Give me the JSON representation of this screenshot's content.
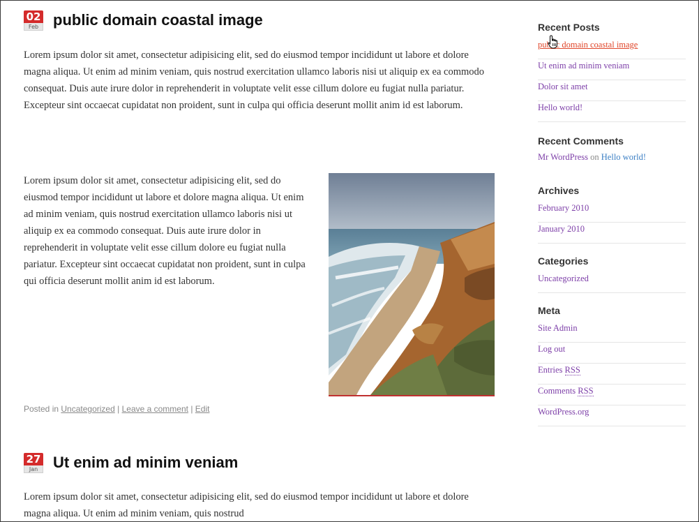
{
  "posts": [
    {
      "day": "02",
      "month": "Feb",
      "title": "public domain coastal image",
      "paragraphs": [
        "Lorem ipsum dolor sit amet, consectetur adipisicing elit, sed do eiusmod tempor incididunt ut labore et dolore magna aliqua. Ut enim ad minim veniam, quis nostrud exercitation ullamco laboris nisi ut aliquip ex ea commodo consequat. Duis aute irure dolor in reprehenderit in voluptate velit esse cillum dolore eu fugiat nulla pariatur. Excepteur sint occaecat cupidatat non proident, sunt in culpa qui officia deserunt mollit anim id est laborum.",
        "Lorem ipsum dolor sit amet, consectetur adipisicing elit, sed do eiusmod tempor incididunt ut labore et dolore magna aliqua. Ut enim ad minim veniam, quis nostrud exercitation ullamco laboris nisi ut aliquip ex ea commodo consequat. Duis aute irure dolor in reprehenderit in voluptate velit esse cillum dolore eu fugiat nulla pariatur. Excepteur sint occaecat cupidatat non proident, sunt in culpa qui officia deserunt mollit anim id est laborum."
      ],
      "meta": {
        "posted_in": "Posted in",
        "category": "Uncategorized",
        "sep": "|",
        "comment": "Leave a comment",
        "edit": "Edit"
      }
    },
    {
      "day": "27",
      "month": "Jan",
      "title": "Ut enim ad minim veniam",
      "paragraphs": [
        "Lorem ipsum dolor sit amet, consectetur adipisicing elit, sed do eiusmod tempor incididunt ut labore et dolore magna aliqua. Ut enim ad minim veniam, quis nostrud"
      ]
    }
  ],
  "sidebar": {
    "recent_posts": {
      "title": "Recent Posts",
      "items": [
        "public domain coastal image",
        "Ut enim ad minim veniam",
        "Dolor sit amet",
        "Hello world!"
      ]
    },
    "recent_comments": {
      "title": "Recent Comments",
      "author": "Mr WordPress",
      "on": "on",
      "post": "Hello world!"
    },
    "archives": {
      "title": "Archives",
      "items": [
        "February 2010",
        "January 2010"
      ]
    },
    "categories": {
      "title": "Categories",
      "items": [
        "Uncategorized"
      ]
    },
    "meta": {
      "title": "Meta",
      "site_admin": "Site Admin",
      "log_out": "Log out",
      "entries": "Entries",
      "comments": "Comments",
      "rss": "RSS",
      "wordpress_org": "WordPress.org"
    }
  },
  "colors": {
    "link_visited": "#7d3fa8",
    "link_hover": "#e0462a",
    "link_post": "#3b7fc4",
    "date_badge": "#d42b2b"
  },
  "icons": {
    "cursor": "hand-pointer-icon"
  }
}
